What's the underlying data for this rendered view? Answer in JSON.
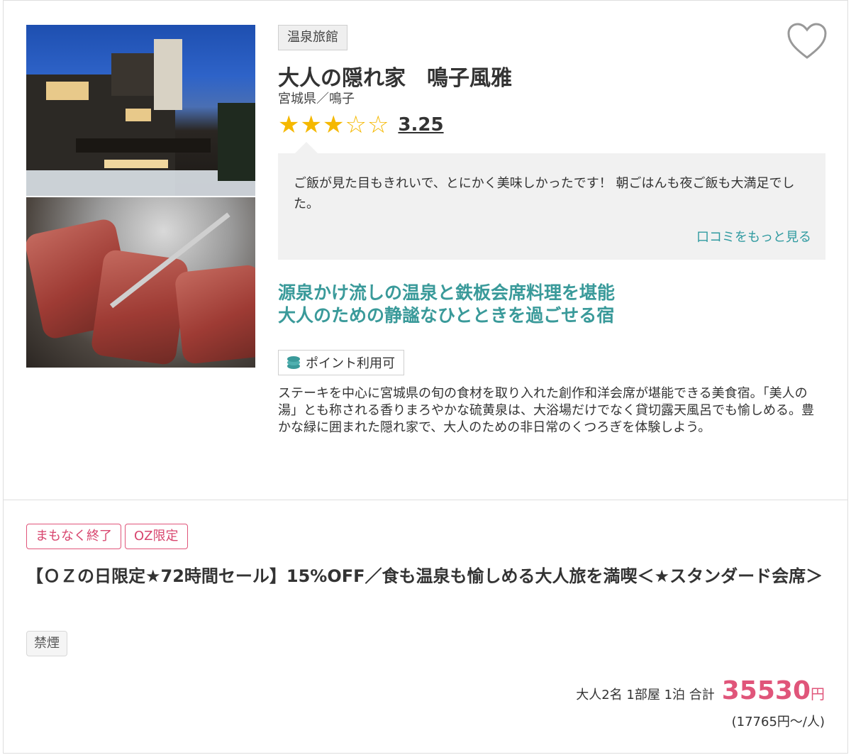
{
  "hotel": {
    "type_badge": "温泉旅館",
    "name": "大人の隠れ家　鳴子風雅",
    "location": "宮城県／鳴子",
    "rating": {
      "value": 3.25,
      "label": "3.25",
      "stars_full": 3,
      "stars_total": 5
    }
  },
  "review": {
    "text": "ご飯が見た目もきれいで、とにかく美味しかったです！ 朝ごはんも夜ご飯も大満足でした。",
    "more_label": "口コミをもっと見る"
  },
  "catchphrase": {
    "line1": "源泉かけ流しの温泉と鉄板会席料理を堪能",
    "line2": "大人のための静謐なひとときを過ごせる宿"
  },
  "points_badge": "ポイント利用可",
  "description": "ステーキを中心に宮城県の旬の食材を取り入れた創作和洋会席が堪能できる美食宿。「美人の湯」とも称される香りまろやかな硫黄泉は、大浴場だけでなく貸切露天風呂でも愉しめる。豊かな緑に囲まれた隠れ家で、大人のための非日常のくつろぎを体験しよう。",
  "plan": {
    "tags": [
      "まもなく終了",
      "OZ限定"
    ],
    "title": "【ＯＺの日限定★72時間セール】15%OFF／食も温泉も愉しめる大人旅を満喫＜★スタンダード会席＞",
    "smoking": "禁煙",
    "conditions": "大人2名 1部屋 1泊 合計",
    "price": "35530",
    "yen": "円",
    "per_person": "(17765円～/人)"
  },
  "colors": {
    "accent_pink": "#e0557a",
    "teal": "#3a9a9a",
    "star": "#f5b800"
  }
}
